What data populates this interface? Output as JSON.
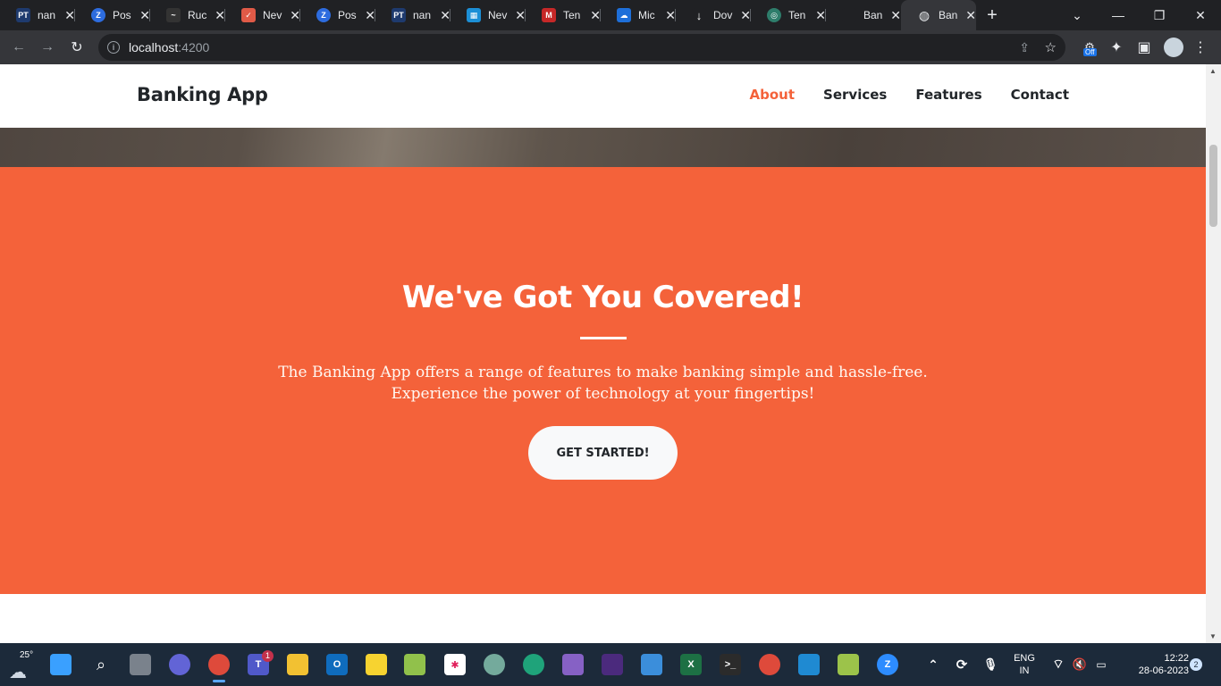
{
  "browser": {
    "tabs": [
      {
        "favicon": "PT",
        "title": "nan",
        "color": "#1e3a6e"
      },
      {
        "favicon": "Z",
        "title": "Pos",
        "color": "#2d6cdf"
      },
      {
        "favicon": "~",
        "title": "Ruc",
        "color": "#333333"
      },
      {
        "favicon": "✓",
        "title": "Nev",
        "color": "#e05a47"
      },
      {
        "favicon": "Z",
        "title": "Pos",
        "color": "#2d6cdf"
      },
      {
        "favicon": "PT",
        "title": "nan",
        "color": "#1e3a6e"
      },
      {
        "favicon": "▦",
        "title": "Nev",
        "color": "#1c8fd6"
      },
      {
        "favicon": "M",
        "title": "Ten",
        "color": "#c62828"
      },
      {
        "favicon": "☁",
        "title": "Mic",
        "color": "#1e6fd9"
      },
      {
        "favicon": "↓",
        "title": "Dov",
        "color": "#202124"
      },
      {
        "favicon": "◎",
        "title": "Ten",
        "color": "#2e7d6b"
      },
      {
        "favicon": "",
        "title": "Ban",
        "color": "#202124"
      },
      {
        "favicon": "◍",
        "title": "Ban",
        "color": "#35363a"
      }
    ],
    "url_host": "localhost",
    "url_port": ":4200",
    "extension_badge": "Off"
  },
  "page": {
    "brand": "Banking App",
    "nav": [
      "About",
      "Services",
      "Features",
      "Contact"
    ],
    "heading": "We've Got You Covered!",
    "line1": "The Banking App offers a range of features to make banking simple and hassle-free.",
    "line2": "Experience the power of technology at your fingertips!",
    "cta": "GET STARTED!"
  },
  "taskbar": {
    "weather": "25°",
    "teams_badge": "1",
    "lang": "ENG",
    "region": "IN",
    "time": "12:22",
    "date": "28-06-2023",
    "notifications": "2"
  },
  "colors": {
    "accent": "#f4623a"
  }
}
